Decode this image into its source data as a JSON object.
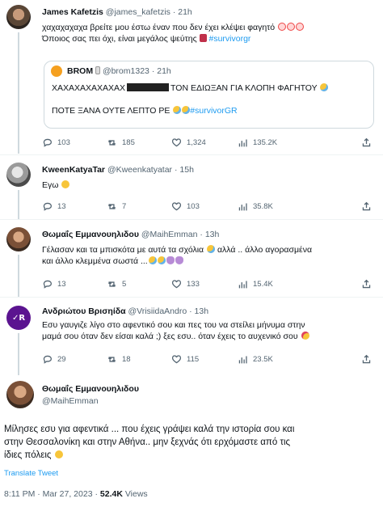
{
  "tweets": [
    {
      "name": "James Kafetzis",
      "handle": "@james_kafetzis",
      "time": "21h",
      "line1": "χαχαχαχαχα βρείτε μου έστω έναν που δεν έχει κλέψει φαγητό",
      "line2": "Όποιος σας πει όχι, είναι μεγάλος ψεύτης",
      "hashtag": "#survivorgr",
      "quote": {
        "name": "BROM",
        "handle": "@brom1323",
        "time": "21h",
        "line1_a": "ΧΑΧΑΧΑΧΑΧΑΧΑΧ",
        "line1_b": "ΤΟΝ ΕΔΙΩΞΑΝ ΓΙΑ ΚΛΟΠΗ ΦΑΓΗΤΟΥ",
        "line2": "ΠΟΤΕ ΞΑΝΑ ΟΥΤΕ ΛΕΠΤΟ ΡΕ",
        "hashtag": "#survivorGR"
      },
      "replies": "103",
      "retweets": "185",
      "likes": "1,324",
      "views": "135.2K"
    },
    {
      "name": "KweenKatyaTar",
      "handle": "@Kweenkatyatar",
      "time": "15h",
      "text": "Εγω",
      "replies": "13",
      "retweets": "7",
      "likes": "103",
      "views": "35.8K"
    },
    {
      "name": "Θωμαΐς Εμμανουηλιδου",
      "handle": "@MaihEmman",
      "time": "13h",
      "line1": "Γέλασαν και τα μπισκότα με αυτά τα σχόλια",
      "line1_b": "αλλά .. άλλο αγορασμένα",
      "line2": "και άλλο κλεμμένα σωστά ...",
      "replies": "13",
      "retweets": "5",
      "likes": "133",
      "views": "15.4K"
    },
    {
      "name": "Ανδριώτου Βρισηίδα",
      "handle": "@VrisiidaAndro",
      "time": "13h",
      "line1": "Εσυ γαυγιζε λίγο στο αφεντικό σου και πες του να στείλει μήνυμα στην",
      "line2": "μαμά σου όταν δεν είσαι καλά  ;) ξες εσυ.. όταν έχεις το αυχενικό σου",
      "replies": "29",
      "retweets": "18",
      "likes": "115",
      "views": "23.5K"
    }
  ],
  "main": {
    "name": "Θωμαΐς Εμμανουηλιδου",
    "handle": "@MaihEmman",
    "line1": "Μίλησες εσυ για αφεντικά ... που έχεις γράψει καλά την ιστορία σου και",
    "line2": "στην Θεσσαλονίκη και στην Αθήνα.. μην ξεχνάς ότι ερχόμαστε από τις",
    "line3": "ίδιες πόλεις",
    "translate": "Translate Tweet",
    "time": "8:11 PM",
    "date": "Mar 27, 2023",
    "views_count": "52.4K",
    "views_label": "Views"
  }
}
